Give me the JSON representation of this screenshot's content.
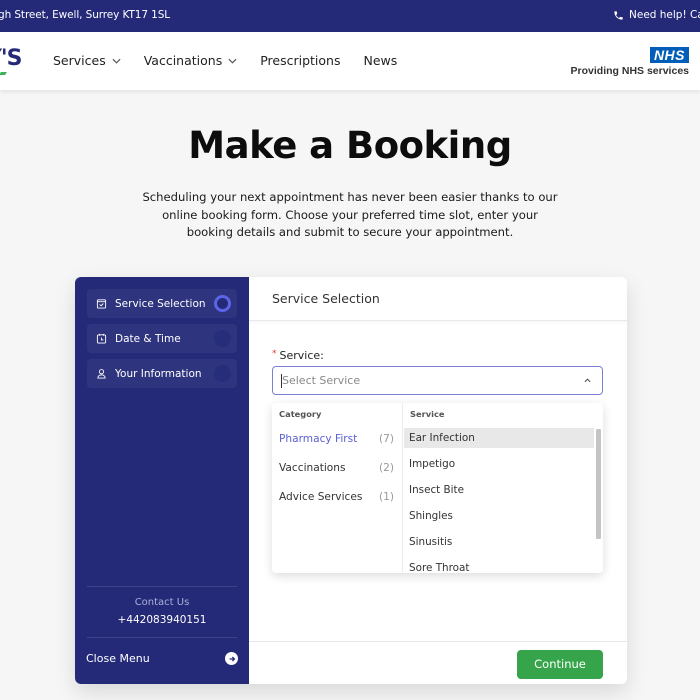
{
  "topbar": {
    "address": "gh Street, Ewell, Surrey KT17 1SL",
    "help": "Need help! Ca"
  },
  "header": {
    "logo_text": "Y'S",
    "nav": [
      {
        "label": "Services",
        "has_dropdown": true
      },
      {
        "label": "Vaccinations",
        "has_dropdown": true
      },
      {
        "label": "Prescriptions",
        "has_dropdown": false
      },
      {
        "label": "News",
        "has_dropdown": false
      }
    ],
    "nhs_badge": "NHS",
    "nhs_text": "Providing NHS services"
  },
  "hero": {
    "title": "Make a Booking",
    "subtitle": "Scheduling your next appointment has never been easier thanks to our online booking form. Choose your preferred time slot, enter your booking details and submit to secure your appointment."
  },
  "booking": {
    "steps": [
      {
        "label": "Service Selection",
        "icon": "bag-check-icon",
        "active": true
      },
      {
        "label": "Date & Time",
        "icon": "calendar-icon",
        "active": false
      },
      {
        "label": "Your Information",
        "icon": "user-icon",
        "active": false
      }
    ],
    "contact_label": "Contact Us",
    "contact_phone": "+442083940151",
    "close_menu": "Close Menu",
    "panel_title": "Service Selection",
    "field_label": "Service:",
    "required_mark": "*",
    "select_placeholder": "Select Service",
    "dropdown": {
      "category_header": "Category",
      "service_header": "Service",
      "categories": [
        {
          "label": "Pharmacy First",
          "count": "(7)",
          "active": true
        },
        {
          "label": "Vaccinations",
          "count": "(2)",
          "active": false
        },
        {
          "label": "Advice Services",
          "count": "(1)",
          "active": false
        }
      ],
      "services": [
        {
          "label": "Ear Infection",
          "highlighted": true
        },
        {
          "label": "Impetigo",
          "highlighted": false
        },
        {
          "label": "Insect Bite",
          "highlighted": false
        },
        {
          "label": "Shingles",
          "highlighted": false
        },
        {
          "label": "Sinusitis",
          "highlighted": false
        },
        {
          "label": "Sore Throat",
          "highlighted": false
        }
      ]
    },
    "continue_label": "Continue"
  },
  "colors": {
    "brand_navy": "#242a78",
    "accent_blue": "#5a61d6",
    "continue_green": "#36a44b",
    "nhs_blue": "#005eb8"
  }
}
